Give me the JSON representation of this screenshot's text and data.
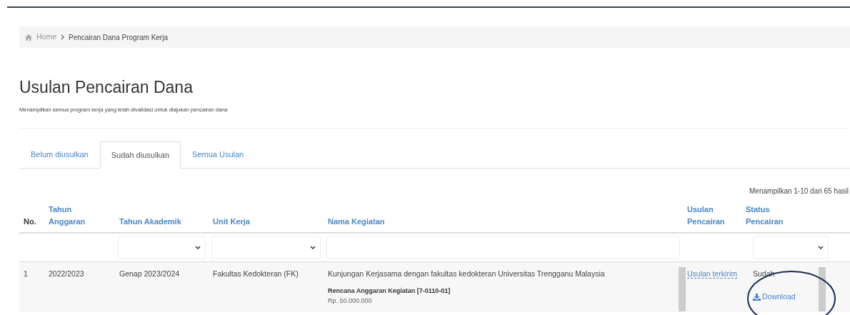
{
  "breadcrumb": [
    "Home",
    "Pencairan Dana Program Kerja"
  ],
  "title": "Usulan Pencairan Dana",
  "subtitle": "Menampilkan semua program kerja yang telah divalidasi untuk diajukan pencairan dana",
  "tabs": [
    {
      "label": "Belum diusulkan",
      "selected": false
    },
    {
      "label": "Sudah diusulkan",
      "selected": true
    },
    {
      "label": "Semua Usulan",
      "selected": false
    }
  ],
  "summary": "Menampilkan 1-10 dari 65 hasil",
  "table": {
    "columns": [
      {
        "label": "No.",
        "kind": "plain"
      },
      {
        "label": "Tahun Anggaran",
        "kind": "sort"
      },
      {
        "label": "Tahun Akademik",
        "kind": "sort",
        "filter": {
          "kind": "select"
        }
      },
      {
        "label": "Unit Kerja",
        "kind": "sort",
        "filter": {
          "kind": "select"
        }
      },
      {
        "label": "Nama Kegiatan",
        "kind": "sort",
        "filter": {
          "kind": "text"
        }
      },
      {
        "label": "Usulan Pencairan",
        "kind": "sort"
      },
      {
        "label": "Status Pencairan",
        "kind": "sort",
        "filter": {
          "kind": "select"
        }
      }
    ],
    "rows": [
      {
        "no": "1",
        "tahun_anggaran": "2022/2023",
        "tahun_akademik": "Genap 2023/2024",
        "unit_kerja": "Fakultas Kedokteran (FK)",
        "nama_kegiatan": "Kunjungan Kerjasama dengan fakultas kedokteran Universitas Trengganu Malaysia",
        "rencana": "Rencana Anggaran Kegiatan [7-0110-01]",
        "amount": "Rp. 50.000.000",
        "usulan_link": "Usulan terkirim",
        "status": "Sudah",
        "download": "Download"
      }
    ]
  }
}
